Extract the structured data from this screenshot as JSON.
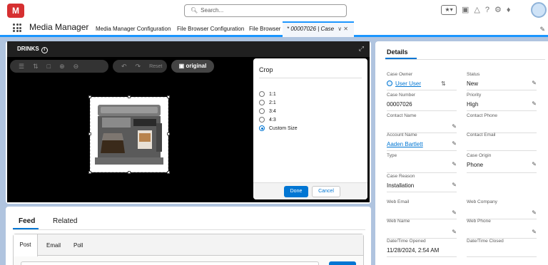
{
  "header": {
    "logo_text": "M",
    "search_placeholder": "Search...",
    "icons": [
      "favorites-icon",
      "add-icon",
      "trailhead-icon",
      "help-icon",
      "setup-icon",
      "notifications-icon",
      "avatar"
    ]
  },
  "nav": {
    "app_name": "Media Manager",
    "items": [
      "Media Manager Configuration",
      "File Browser Configuration",
      "File Browser"
    ],
    "active_tab": "* 00007026 | Case"
  },
  "editor": {
    "title": "DRINKS",
    "reset_label": "Reset",
    "original_label": "original",
    "crop": {
      "heading": "Crop",
      "options": [
        "1:1",
        "2:1",
        "3:4",
        "4:3",
        "Custom Size"
      ],
      "selected": "Custom Size",
      "done_label": "Done",
      "cancel_label": "Cancel"
    }
  },
  "feed": {
    "tabs": [
      "Feed",
      "Related"
    ],
    "composer_tabs": [
      "Post",
      "Email",
      "Poll"
    ]
  },
  "details": {
    "title": "Details",
    "fields": [
      {
        "label": "Case Owner",
        "value": "User User",
        "link": true
      },
      {
        "label": "Status",
        "value": "New"
      },
      {
        "label": "Case Number",
        "value": "00007026"
      },
      {
        "label": "Priority",
        "value": "High"
      },
      {
        "label": "Contact Name",
        "value": ""
      },
      {
        "label": "Contact Phone",
        "value": ""
      },
      {
        "label": "Account Name",
        "value": "Aaden Bartlett",
        "link": true
      },
      {
        "label": "Contact Email",
        "value": ""
      },
      {
        "label": "Type",
        "value": ""
      },
      {
        "label": "Case Origin",
        "value": "Phone"
      },
      {
        "label": "Case Reason",
        "value": "Installation"
      },
      {
        "label": "Web Email",
        "value": ""
      },
      {
        "label": "Web Company",
        "value": ""
      },
      {
        "label": "Web Name",
        "value": ""
      },
      {
        "label": "Web Phone",
        "value": ""
      },
      {
        "label": "Date/Time Opened",
        "value": "11/28/2024, 2:54 AM"
      },
      {
        "label": "Date/Time Closed",
        "value": ""
      }
    ]
  },
  "colors": {
    "brand": "#0176d3",
    "logo": "#d63031",
    "background": "#b0c4df",
    "editor_bg": "#000000"
  }
}
